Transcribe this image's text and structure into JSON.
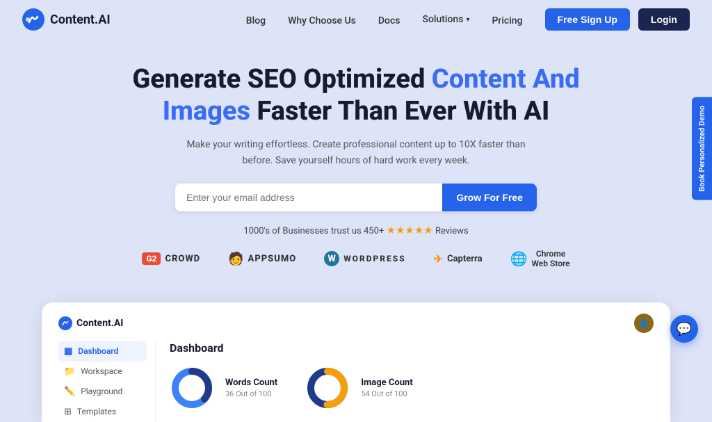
{
  "brand": {
    "name": "Content.AI",
    "logo_text": "Content.AI"
  },
  "navbar": {
    "links": [
      {
        "label": "Blog",
        "id": "blog"
      },
      {
        "label": "Why Choose Us",
        "id": "why-choose"
      },
      {
        "label": "Docs",
        "id": "docs"
      },
      {
        "label": "Solutions",
        "id": "solutions",
        "has_dropdown": true
      },
      {
        "label": "Pricing",
        "id": "pricing"
      }
    ],
    "free_signup_label": "Free Sign Up",
    "login_label": "Login"
  },
  "hero": {
    "heading_part1": "Generate SEO Optimized ",
    "heading_highlight": "Content And Images",
    "heading_part2": " Faster Than Ever With AI",
    "subtext": "Make your writing effortless. Create professional content up to 10X faster than before. Save yourself hours of hard work every week.",
    "email_placeholder": "Enter your email address",
    "cta_label": "Grow For Free"
  },
  "trust": {
    "text": "1000's of Businesses trust us 450+",
    "stars": "★★★★★",
    "suffix": "Reviews"
  },
  "partner_logos": [
    {
      "id": "g2crowd",
      "label": "G2CROWD",
      "icon": "G2",
      "color": "#e84e36"
    },
    {
      "id": "appsumo",
      "label": "APPSUMO",
      "icon": "🧑",
      "color": "#ff7a00"
    },
    {
      "id": "wordpress",
      "label": "WORDPRESS",
      "icon": "W",
      "color": "#21759b"
    },
    {
      "id": "capterra",
      "label": "Capterra",
      "icon": "✈",
      "color": "#ff9500"
    },
    {
      "id": "chrome",
      "label": "Chrome Web Store",
      "icon": "🌐",
      "color": "#4285f4"
    }
  ],
  "dashboard": {
    "logo": "Content.AI",
    "title": "Dashboard",
    "sidebar_items": [
      {
        "label": "Dashboard",
        "icon": "▦",
        "active": true
      },
      {
        "label": "Workspace",
        "icon": "📁",
        "active": false
      },
      {
        "label": "Playground",
        "icon": "✏️",
        "active": false
      },
      {
        "label": "Templates",
        "icon": "⊞",
        "active": false
      }
    ],
    "stats": [
      {
        "id": "words",
        "title": "Words Count",
        "value": "36 Out of 100",
        "used": 36,
        "total": 100,
        "color_used": "#1e3a8a",
        "color_remaining": "#3b82f6"
      },
      {
        "id": "images",
        "title": "Image Count",
        "value": "54 Out of 100",
        "used": 54,
        "total": 100,
        "color_used": "#f59e0b",
        "color_remaining": "#1e3a8a"
      }
    ]
  },
  "side_tab": {
    "label": "Book Personalized Demo"
  },
  "chat_bubble": {
    "icon": "💬"
  }
}
